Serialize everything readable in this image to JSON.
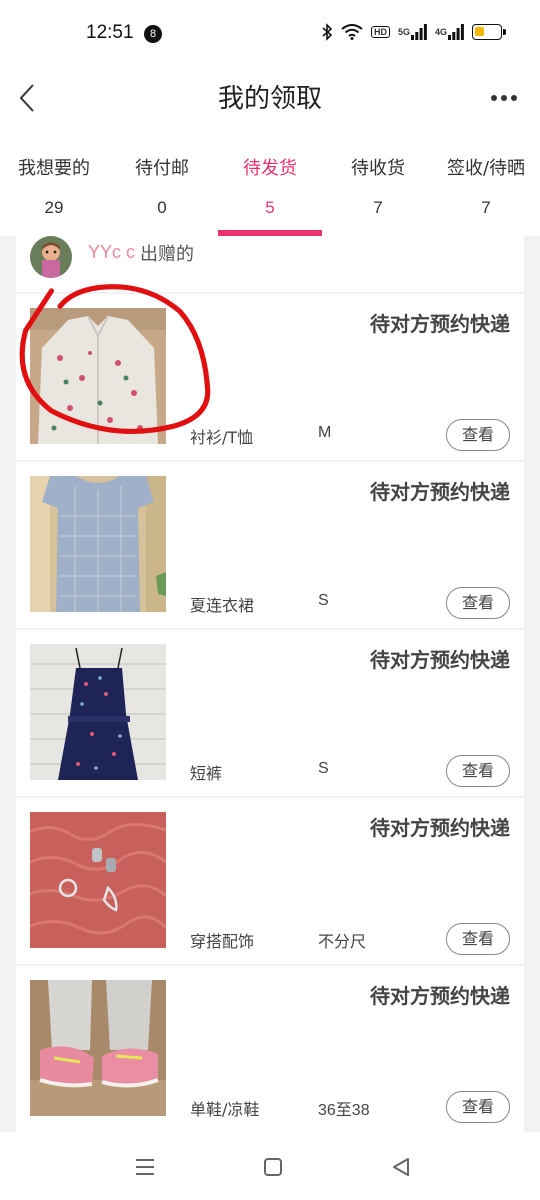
{
  "status_bar": {
    "time": "12:51",
    "notification_count": "8",
    "hd_label": "HD",
    "sig1_label": "5G",
    "sig2_label": "4G",
    "battery_level": 0.4
  },
  "header": {
    "title": "我的领取"
  },
  "tabs": [
    {
      "label": "我想要的",
      "count": "29"
    },
    {
      "label": "待付邮",
      "count": "0"
    },
    {
      "label": "待发货",
      "count": "5"
    },
    {
      "label": "待收货",
      "count": "7"
    },
    {
      "label": "签收/待晒",
      "count": "7"
    }
  ],
  "active_tab": 2,
  "giver": {
    "name": "YYc c",
    "suffix": "出赠的"
  },
  "items": [
    {
      "status": "待对方预约快递",
      "category": "衬衫/T恤",
      "size": "M",
      "view_label": "查看",
      "image": "floral-shirt"
    },
    {
      "status": "待对方预约快递",
      "category": "夏连衣裙",
      "size": "S",
      "view_label": "查看",
      "image": "gingham-dress"
    },
    {
      "status": "待对方预约快递",
      "category": "短裤",
      "size": "S",
      "view_label": "查看",
      "image": "navy-romper"
    },
    {
      "status": "待对方预约快递",
      "category": "穿搭配饰",
      "size": "不分尺",
      "view_label": "查看",
      "image": "earrings"
    },
    {
      "status": "待对方预约快递",
      "category": "单鞋/凉鞋",
      "size": "36至38",
      "view_label": "查看",
      "image": "pink-sneakers"
    }
  ],
  "colors": {
    "accent": "#e8336c",
    "giver_name": "#f08a9a",
    "annotation": "#e01010"
  }
}
